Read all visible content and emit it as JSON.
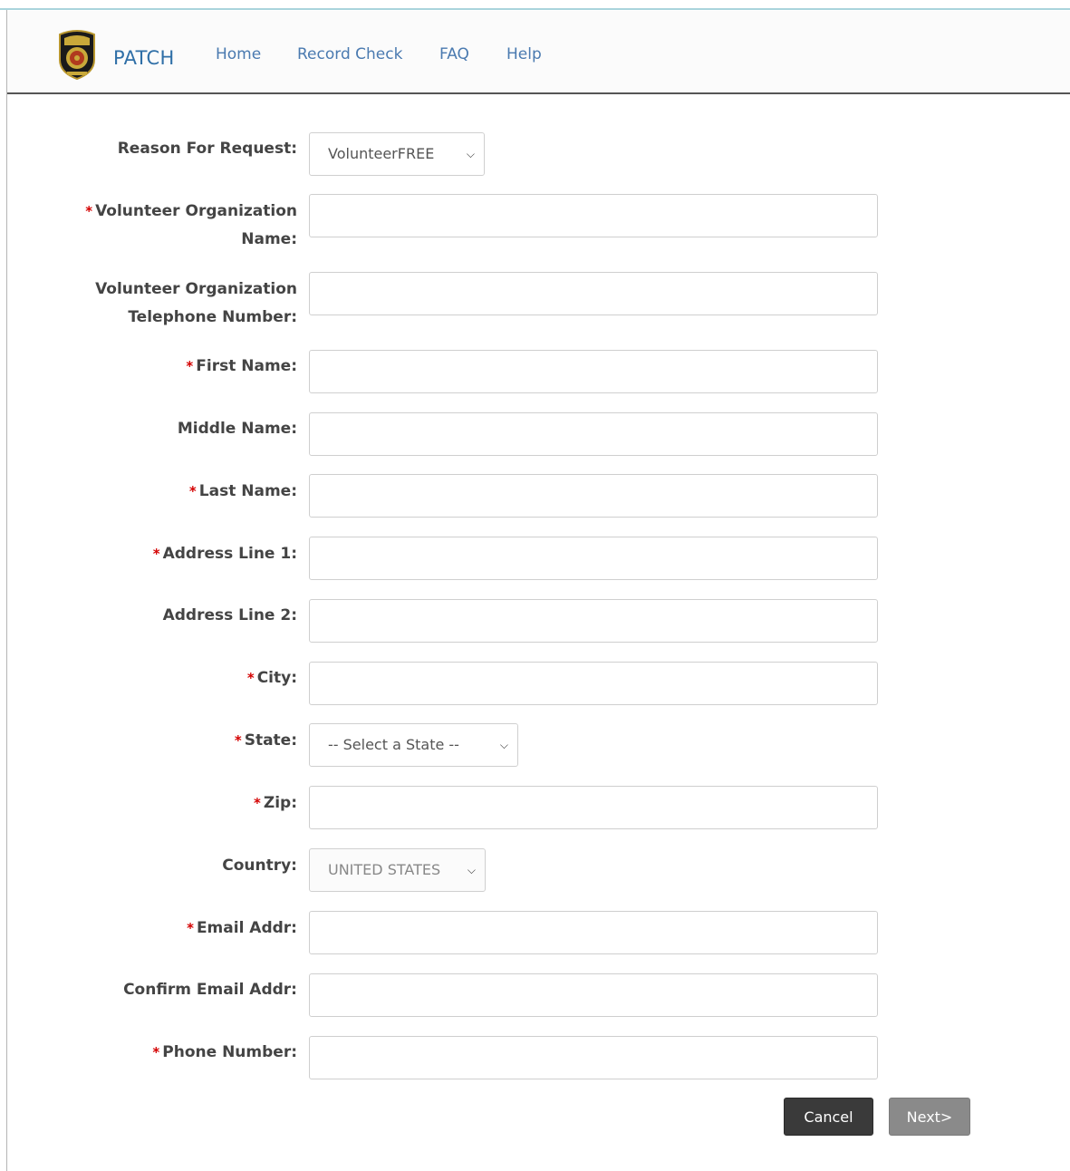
{
  "header": {
    "brand": "PATCH",
    "nav": [
      "Home",
      "Record Check",
      "FAQ",
      "Help"
    ]
  },
  "form": {
    "reason_label": "Reason For Request:",
    "reason_value": "VolunteerFREE",
    "org_name_label_1": "Volunteer Organization",
    "org_name_label_2": "Name:",
    "org_phone_label_1": "Volunteer Organization",
    "org_phone_label_2": "Telephone Number:",
    "first_name_label": "First Name:",
    "middle_name_label": "Middle Name:",
    "last_name_label": "Last Name:",
    "address1_label": "Address Line 1:",
    "address2_label": "Address Line 2:",
    "city_label": "City:",
    "state_label": "State:",
    "state_value": "-- Select a State --",
    "zip_label": "Zip:",
    "country_label": "Country:",
    "country_value": "UNITED STATES",
    "email_label": "Email Addr:",
    "confirm_email_label": "Confirm Email Addr:",
    "phone_label": "Phone Number:",
    "required_marker": "*"
  },
  "buttons": {
    "cancel": "Cancel",
    "next": "Next>"
  },
  "colors": {
    "brand": "#2f6fa7",
    "nav_link": "#4a7ab0",
    "required": "#d40000",
    "cancel_bg": "#3a3a3a",
    "next_bg": "#8a8a8a"
  }
}
